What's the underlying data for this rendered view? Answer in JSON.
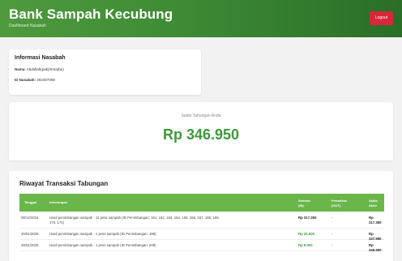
{
  "header": {
    "title": "Bank Sampah Kecubung",
    "subtitle": "Dashboard Nasabah",
    "logout_label": "Logout"
  },
  "info": {
    "title": "Informasi Nasabah",
    "name_label": "Nama:",
    "name_value": "Abdullah(pak)/Irma(bu)",
    "id_label": "ID Nasabah:",
    "id_value": "202407008"
  },
  "saldo": {
    "label": "Saldo Tabungan Anda",
    "value": "Rp 346.950"
  },
  "riwayat": {
    "title": "Riwayat Transaksi Tabungan",
    "columns": {
      "tanggal": "Tanggal",
      "keterangan": "Keterangan",
      "setoran_1": "Setoran",
      "setoran_2": "(IN)",
      "penarikan_1": "Penarikan",
      "penarikan_2": "(OUT)",
      "saldo_1": "Saldo",
      "saldo_2": "Akhir"
    },
    "rows": [
      {
        "tanggal": "08/12/2024",
        "keterangan_1": "Hasil penimbangan sampah - 11 jenis sampah (ID Penimbangan: 161, 162, 163, 164, 165, 166, 167, 168, 169,",
        "keterangan_2": "170, 171)",
        "setoran": "Rp 317.350",
        "penarikan": "-",
        "saldo": "Rp 317.350"
      },
      {
        "tanggal": "26/01/2025",
        "keterangan_1": "Hasil penimbangan sampah - 1 jenis sampah (ID Penimbangan: 198)",
        "setoran": "Rp 20.600",
        "penarikan": "-",
        "saldo": "Rp 337.950"
      },
      {
        "tanggal": "28/01/2026",
        "keterangan_1": "Hasil penimbangan sampah - 1 jenis sampah (ID Penimbangan: 209)",
        "setoran": "Rp 9.000",
        "penarikan": "-",
        "saldo": "Rp 346.950"
      }
    ]
  },
  "colors": {
    "header_green": "#3d8b35",
    "table_head_green": "#6ab64a",
    "saldo_green": "#3c9a3a",
    "logout_red": "#d62839"
  }
}
